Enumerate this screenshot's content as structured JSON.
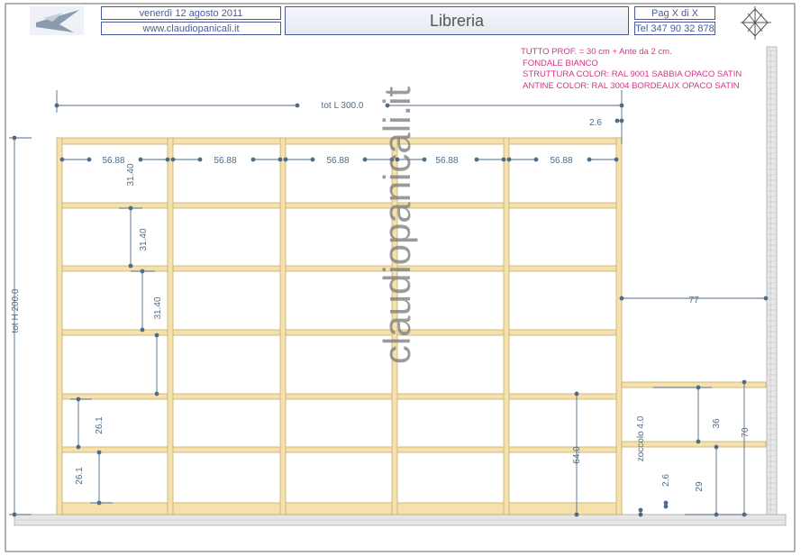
{
  "header": {
    "date": "venerdì 12 agosto 2011",
    "website": "www.claudiopanicali.it",
    "title": "Libreria",
    "page": "Pag X di X",
    "phone": "Tel 347 90 32 878"
  },
  "notes": [
    "TUTTO PROF. = 30 cm + Ante da 2 cm.",
    "FONDALE BIANCO",
    "STRUTTURA COLOR: RAL 9001 SABBIA OPACO SATIN",
    "ANTINE COLOR: RAL 3004 BORDEAUX OPACO SATIN"
  ],
  "watermark": "claudiopanicali.it",
  "dimensions": {
    "total_width": "tot L 300.0",
    "total_height": "tot H 200.0",
    "top_thickness": "2.6",
    "column_widths": [
      "56.88",
      "56.88",
      "56.88",
      "56.88",
      "56.88"
    ],
    "shelf_spacings": [
      "31.40",
      "31.40",
      "31.40"
    ],
    "lower_spacing_1": "26.1",
    "lower_spacing_2": "26.1",
    "right_depth": "77",
    "right_height_36": "36",
    "right_height_70": "70",
    "right_height_29": "29",
    "right_thickness": "2.6",
    "plinth": "zoccolo 4.0",
    "lower_height": "64.0"
  },
  "colors": {
    "wood": "#f4e1ad",
    "wood_edge": "#c9ad6a",
    "dimension": "#4f6b86",
    "notes": "#d6338a",
    "border": "#4a5aa0"
  }
}
